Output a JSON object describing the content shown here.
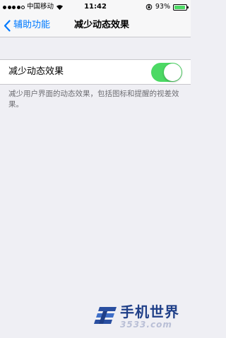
{
  "status_bar": {
    "carrier": "中国移动",
    "time": "11:42",
    "battery_percent": "93%",
    "battery_level": 0.93,
    "signal_bars_filled": 4,
    "signal_bars_total": 5
  },
  "nav": {
    "back_label": "辅助功能",
    "title": "减少动态效果"
  },
  "setting": {
    "label": "减少动态效果",
    "enabled": true,
    "description": "减少用户界面的动态效果，包括图标和提醒的视差效果。"
  },
  "watermark": {
    "title": "手机世界",
    "domain": "3533.com"
  },
  "colors": {
    "accent": "#007aff",
    "toggle_on": "#4cd964",
    "background": "#efeff4",
    "watermark_blue": "#1f3f88"
  }
}
